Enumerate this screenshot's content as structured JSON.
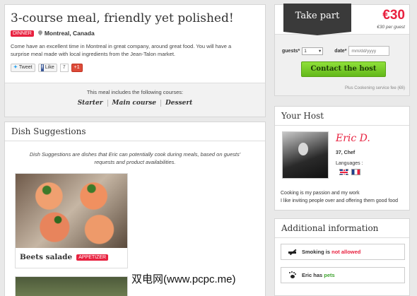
{
  "meal": {
    "title": "3-course meal, friendly yet polished!",
    "tag": "DINNER",
    "location": "Montreal, Canada",
    "description": "Come have an excellent time in Montreal in great company, around great food. You will have a surprise meal made with local ingredients from the Jean-Talon market.",
    "social": {
      "tweet_label": "Tweet",
      "like_label": "Like",
      "like_count": "7",
      "gplus_label": "+1"
    },
    "courses_intro": "This meal includes the following courses:",
    "courses": [
      "Starter",
      "Main course",
      "Dessert"
    ]
  },
  "dish_suggestions": {
    "heading": "Dish Suggestions",
    "intro": "Dish Suggestions are dishes that Eric can potentially cook during meals, based on guests' requests and product availabilities.",
    "dishes": [
      {
        "name": "Beets salade",
        "tag": "APPETIZER"
      }
    ]
  },
  "booking": {
    "take_part_label": "Take part",
    "price": "€30",
    "price_note": "€30 per guest",
    "guests_label": "guests*",
    "guests_value": "1",
    "date_label": "date*",
    "date_placeholder": "mm/dd/yyyy",
    "contact_label": "Contact the host",
    "fee_note": "Plus Cookening service fee (€6)"
  },
  "host": {
    "heading": "Your Host",
    "name": "Eric D.",
    "age_profession": "37, Chef",
    "languages_label": "Languages :",
    "bio_lines": [
      "Cooking is my passion and my work",
      "I like inviting people over and offering them good food"
    ]
  },
  "additional_info": {
    "heading": "Additional information",
    "smoking_prefix": "Smoking is",
    "smoking_value": "not allowed",
    "pets_prefix": "Eric has",
    "pets_value": "pets"
  },
  "watermark": "双电网(www.pcpc.me)",
  "colors": {
    "accent_red": "#e8213f",
    "contact_green": "#7ed321"
  },
  "icons": [
    "location-pin-icon",
    "no-smoking-icon",
    "paw-icon",
    "uk-flag-icon",
    "france-flag-icon"
  ]
}
